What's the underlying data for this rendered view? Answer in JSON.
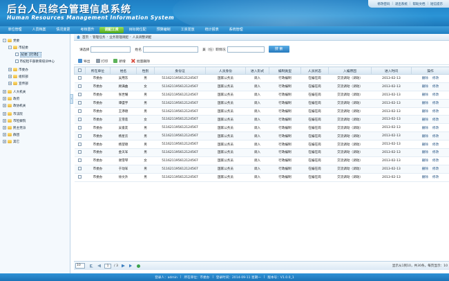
{
  "header": {
    "title_cn": "后台人员综合管理信息系统",
    "title_en": "Human Resources Management Information System",
    "links": [
      "修改密码",
      "退出系统",
      "帮助文档",
      "短信提示"
    ]
  },
  "nav": {
    "items": [
      "单位管理",
      "人员档案",
      "情况变更",
      "考核晋升",
      "调配工资",
      "目标岗位配",
      "预算编制",
      "工资发放",
      "统计报表",
      "系统管理"
    ],
    "active_index": 4
  },
  "sidebar": {
    "items": [
      {
        "label": "党委",
        "level": 0,
        "toggle": "-",
        "icon": "folder"
      },
      {
        "label": "市纪委",
        "level": 1,
        "toggle": "-",
        "icon": "folder"
      },
      {
        "label": "纪委【行政】",
        "level": 2,
        "toggle": "",
        "icon": "doc",
        "selected": true
      },
      {
        "label": "市纪检干部教育培训中心",
        "level": 2,
        "toggle": "",
        "icon": "doc"
      },
      {
        "label": "市委办",
        "level": 1,
        "toggle": "+",
        "icon": "folder"
      },
      {
        "label": "组织部",
        "level": 1,
        "toggle": "+",
        "icon": "folder"
      },
      {
        "label": "宣传部",
        "level": 1,
        "toggle": "+",
        "icon": "folder"
      },
      {
        "label": "人大机关",
        "level": 0,
        "toggle": "+",
        "icon": "folder"
      },
      {
        "label": "政府",
        "level": 0,
        "toggle": "+",
        "icon": "folder"
      },
      {
        "label": "政协机关",
        "level": 0,
        "toggle": "+",
        "icon": "folder"
      },
      {
        "label": "市法院",
        "level": 0,
        "toggle": "+",
        "icon": "folder"
      },
      {
        "label": "市检察院",
        "level": 0,
        "toggle": "+",
        "icon": "folder"
      },
      {
        "label": "民主党派",
        "level": 0,
        "toggle": "+",
        "icon": "folder"
      },
      {
        "label": "群团",
        "level": 0,
        "toggle": "+",
        "icon": "folder"
      },
      {
        "label": "其它",
        "level": 0,
        "toggle": "+",
        "icon": "folder"
      }
    ],
    "collapse_glyph": "‹"
  },
  "breadcrumb": [
    "首页",
    "管理任务",
    "业务管理调配",
    "人员调整调配"
  ],
  "search": {
    "unit_label": "请选择",
    "name_label": "姓名",
    "dept_label": "兼（任）职情况",
    "button": "搜 索"
  },
  "toolbar": [
    "导出",
    "打印",
    "新增",
    "批量删除"
  ],
  "table": {
    "headers": [
      "",
      "所在单位",
      "姓名",
      "性别",
      "身份证",
      "人员身份",
      "进入形式",
      "编制类型",
      "人员状态",
      "入编原因",
      "进入时间",
      "操作"
    ],
    "rows": [
      [
        "市委办",
        "吴用东",
        "男",
        "511621195612124567",
        "国家公务员",
        "调入",
        "行政编制",
        "在编在岗",
        "交流调动（调动）",
        "2013-02-13"
      ],
      [
        "市委办",
        "顾满曲",
        "女",
        "511621195612124567",
        "国家公务员",
        "调入",
        "行政编制",
        "在编在岗",
        "交流调动（调动）",
        "2013-02-13"
      ],
      [
        "市委办",
        "张世耀",
        "男",
        "511621195612124567",
        "国家公务员",
        "调入",
        "行政编制",
        "在编在岗",
        "交流调动（调动）",
        "2013-02-13"
      ],
      [
        "市委办",
        "谭盛宇",
        "男",
        "511621195612124567",
        "国家公务员",
        "调入",
        "行政编制",
        "在编在岗",
        "交流调动（调动）",
        "2013-02-13"
      ],
      [
        "市委办",
        "王添德",
        "男",
        "511621195612124567",
        "国家公务员",
        "调入",
        "行政编制",
        "在编在岗",
        "交流调动（调动）",
        "2013-02-13"
      ],
      [
        "市委办",
        "王雪莲",
        "女",
        "511621195612124567",
        "国家公务员",
        "调入",
        "行政编制",
        "在编在岗",
        "交流调动（调动）",
        "2013-02-13"
      ],
      [
        "市委办",
        "吴俊友",
        "男",
        "511621195612124567",
        "国家公务员",
        "调入",
        "行政编制",
        "在编在岗",
        "交流调动（调动）",
        "2013-02-13"
      ],
      [
        "市委办",
        "杨星云",
        "男",
        "511621195612124567",
        "国家公务员",
        "调入",
        "行政编制",
        "在编在岗",
        "交流调动（调动）",
        "2013-02-13"
      ],
      [
        "市委办",
        "杨望德",
        "男",
        "511621195612124567",
        "国家公务员",
        "调入",
        "行政编制",
        "在编在岗",
        "交流调动（调动）",
        "2013-02-13"
      ],
      [
        "市委办",
        "金天军",
        "男",
        "511621195612124567",
        "国家公务员",
        "调入",
        "行政编制",
        "在编在岗",
        "交流调动（调动）",
        "2013-02-13"
      ],
      [
        "市委办",
        "谢雪琴",
        "女",
        "511621195612124567",
        "国家公务员",
        "调入",
        "行政编制",
        "在编在岗",
        "交流调动（调动）",
        "2013-02-13"
      ],
      [
        "市委办",
        "于动军",
        "男",
        "511621195612124567",
        "国家公务员",
        "调入",
        "行政编制",
        "在编在岗",
        "交流调动（调动）",
        "2013-02-13"
      ],
      [
        "市委办",
        "徐文升",
        "男",
        "511621195612124567",
        "国家公务员",
        "调入",
        "行政编制",
        "在编在岗",
        "交流调动（调动）",
        "2013-02-13"
      ]
    ],
    "ops": [
      "删除",
      "修改"
    ]
  },
  "pager": {
    "page_size": "10",
    "page": "1",
    "total_pages_text": "/ 3",
    "info": "显示从1到10，共30条。每页显示：10"
  },
  "footer": [
    "登录人：admin",
    "|",
    "所在单位：市委办",
    "|",
    "登录时间：2014-09-11 星期一",
    "|",
    "版本号：V1.0.0_1"
  ]
}
